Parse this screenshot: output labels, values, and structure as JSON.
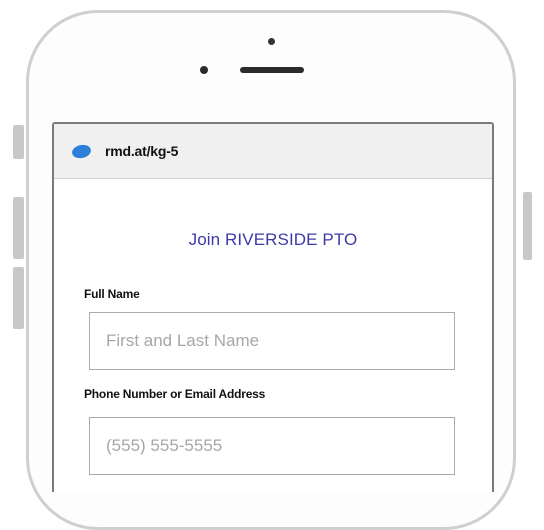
{
  "browser": {
    "url": "rmd.at/kg-5",
    "favicon_icon": "blue-cloud-icon",
    "favicon_color": "#2e7fd8"
  },
  "form": {
    "title": "Join RIVERSIDE PTO",
    "title_color": "#3d3aa8",
    "full_name": {
      "label": "Full Name",
      "placeholder": "First and Last Name"
    },
    "contact": {
      "label": "Phone Number or Email Address",
      "placeholder": "(555) 555-5555"
    }
  }
}
